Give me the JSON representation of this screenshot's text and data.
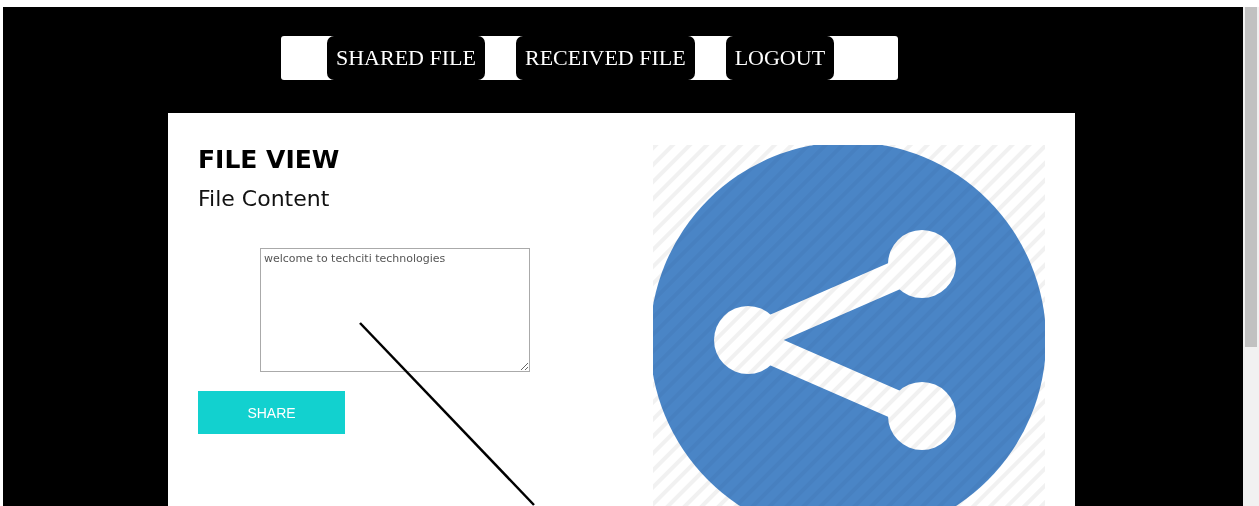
{
  "nav": {
    "buttons": [
      {
        "label": "SHARED FILE"
      },
      {
        "label": "RECEIVED FILE"
      },
      {
        "label": "LOGOUT"
      }
    ]
  },
  "file_view": {
    "title": "FILE VIEW",
    "subtitle": "File Content",
    "content": "welcome to techciti technologies",
    "share_button": "SHARE"
  }
}
